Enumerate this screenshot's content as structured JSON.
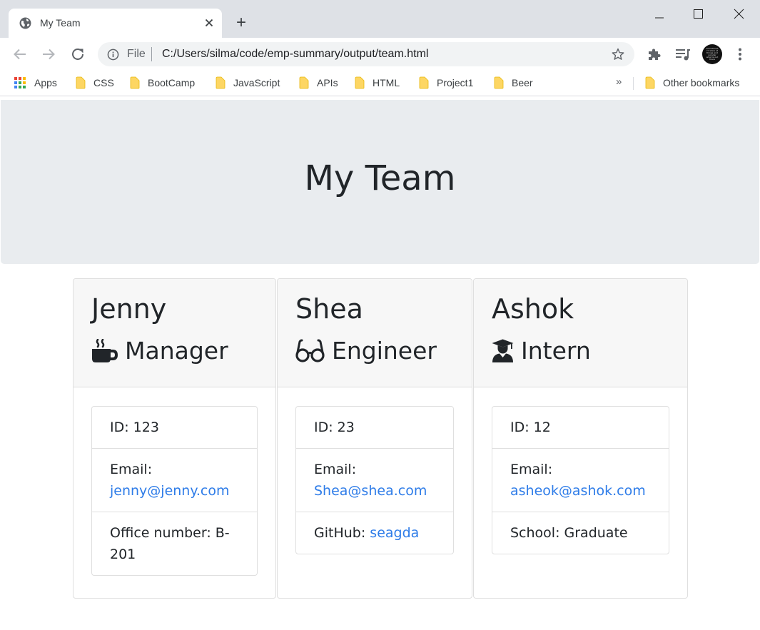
{
  "browser": {
    "tab_title": "My Team",
    "new_tab_label": "+",
    "url_scheme": "File",
    "url": "C:/Users/silma/code/emp-summary/output/team.html",
    "avatar_text": "Sometimes I'd stare at things and wonder what is out there"
  },
  "bookmarks": {
    "apps_label": "Apps",
    "items": [
      {
        "label": "CSS"
      },
      {
        "label": "BootCamp"
      },
      {
        "label": "JavaScript"
      },
      {
        "label": "APIs"
      },
      {
        "label": "HTML"
      },
      {
        "label": "Project1"
      },
      {
        "label": "Beer"
      }
    ],
    "overflow_label": "»",
    "other_label": "Other bookmarks"
  },
  "page": {
    "title": "My Team",
    "colors": {
      "jumbotron_bg": "#e9ecef",
      "link": "#2e7ce8",
      "card_header_bg": "#f7f7f7"
    },
    "cards": [
      {
        "name": "Jenny",
        "role": "Manager",
        "role_icon": "mug-icon",
        "id_text": "ID: 123",
        "email_label": "Email:",
        "email": "jenny@jenny.com",
        "extra_line1": "Office number: B-",
        "extra_line2": "201"
      },
      {
        "name": "Shea",
        "role": "Engineer",
        "role_icon": "glasses-icon",
        "id_text": "ID: 23",
        "email_label": "Email:",
        "email": "Shea@shea.com",
        "github_label": "GitHub:",
        "github": "seagda"
      },
      {
        "name": "Ashok",
        "role": "Intern",
        "role_icon": "graduate-icon",
        "id_text": "ID: 12",
        "email_label": "Email:",
        "email": "asheok@ashok.com",
        "school": "School: Graduate"
      }
    ]
  }
}
